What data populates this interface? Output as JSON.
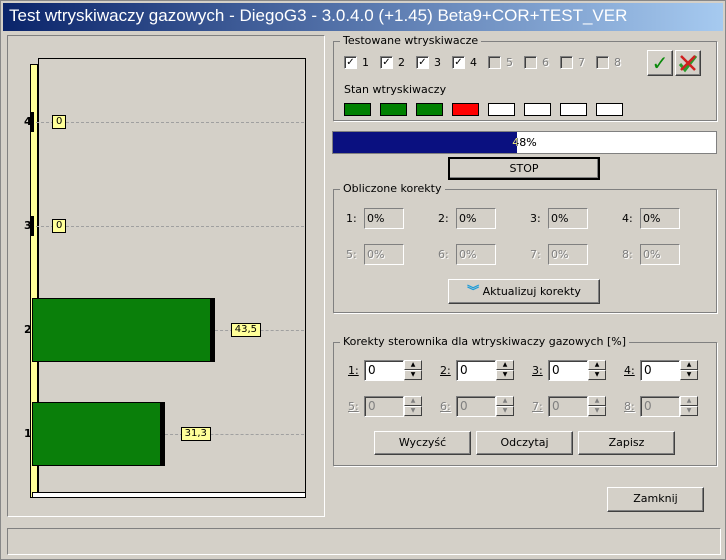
{
  "window": {
    "title": "Test wtryskiwaczy gazowych - DiegoG3 - 3.0.4.0 (+1.45) Beta9+COR+TEST_VER"
  },
  "tested": {
    "label": "Testowane wtryskiwacze",
    "items": [
      {
        "n": "1",
        "checked": true
      },
      {
        "n": "2",
        "checked": true
      },
      {
        "n": "3",
        "checked": true
      },
      {
        "n": "4",
        "checked": true
      },
      {
        "n": "5",
        "checked": false
      },
      {
        "n": "6",
        "checked": false
      },
      {
        "n": "7",
        "checked": false
      },
      {
        "n": "8",
        "checked": false
      }
    ],
    "check_mark": "✓"
  },
  "state": {
    "label": "Stan wtryskiwaczy",
    "colors": [
      "#008000",
      "#008000",
      "#008000",
      "#ff0000",
      "#ffffff",
      "#ffffff",
      "#ffffff",
      "#ffffff"
    ]
  },
  "progress": {
    "value": 48,
    "label": "48%"
  },
  "stop_button": "STOP",
  "computed": {
    "label": "Obliczone korekty",
    "items": [
      {
        "n": "1:",
        "v": "0%"
      },
      {
        "n": "2:",
        "v": "0%"
      },
      {
        "n": "3:",
        "v": "0%"
      },
      {
        "n": "4:",
        "v": "0%"
      },
      {
        "n": "5:",
        "v": "0%"
      },
      {
        "n": "6:",
        "v": "0%"
      },
      {
        "n": "7:",
        "v": "0%"
      },
      {
        "n": "8:",
        "v": "0%"
      }
    ],
    "update_button": "Aktualizuj korekty"
  },
  "corrections": {
    "label": "Korekty sterownika dla wtryskiwaczy gazowych [%]",
    "items": [
      {
        "n": "1:",
        "v": "0"
      },
      {
        "n": "2:",
        "v": "0"
      },
      {
        "n": "3:",
        "v": "0"
      },
      {
        "n": "4:",
        "v": "0"
      },
      {
        "n": "5:",
        "v": "0"
      },
      {
        "n": "6:",
        "v": "0"
      },
      {
        "n": "7:",
        "v": "0"
      },
      {
        "n": "8:",
        "v": "0"
      }
    ],
    "clear_button": "Wyczyść",
    "read_button": "Odczytaj",
    "save_button": "Zapisz"
  },
  "close_button": "Zamknij",
  "chart_data": {
    "type": "bar",
    "orientation": "horizontal",
    "categories": [
      "1",
      "2",
      "3",
      "4"
    ],
    "values": [
      31.3,
      43.5,
      0,
      0
    ],
    "value_labels": [
      "31,3",
      "43,5",
      "0",
      "0"
    ],
    "xlim": [
      0,
      60
    ]
  }
}
